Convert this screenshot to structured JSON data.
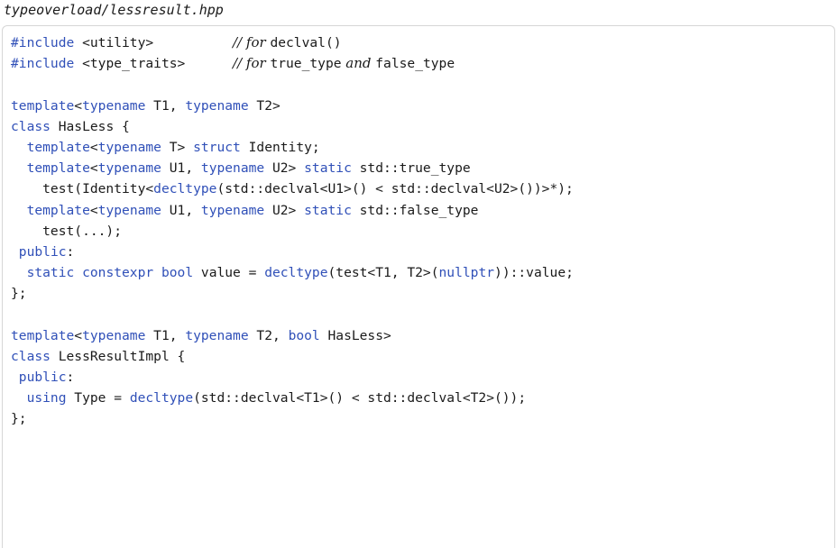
{
  "file_title": "typeoverload/lessresult.hpp",
  "colors": {
    "keyword": "#3050b8",
    "text": "#1a1a1a",
    "border": "#d6d6d6"
  },
  "code_lines": [
    [
      {
        "t": "#include",
        "c": "pp"
      },
      {
        "t": " <utility>          ",
        "c": "plain"
      },
      {
        "t": "// for ",
        "c": "cm"
      },
      {
        "t": "declval()",
        "c": "cm-code"
      }
    ],
    [
      {
        "t": "#include",
        "c": "pp"
      },
      {
        "t": " <type_traits>      ",
        "c": "plain"
      },
      {
        "t": "// for ",
        "c": "cm"
      },
      {
        "t": "true_type",
        "c": "cm-code"
      },
      {
        "t": " and ",
        "c": "cm"
      },
      {
        "t": "false_type",
        "c": "cm-code"
      }
    ],
    [],
    [
      {
        "t": "template",
        "c": "kw"
      },
      {
        "t": "<",
        "c": "plain"
      },
      {
        "t": "typename",
        "c": "kw"
      },
      {
        "t": " T1, ",
        "c": "plain"
      },
      {
        "t": "typename",
        "c": "kw"
      },
      {
        "t": " T2>",
        "c": "plain"
      }
    ],
    [
      {
        "t": "class",
        "c": "kw"
      },
      {
        "t": " HasLess {",
        "c": "plain"
      }
    ],
    [
      {
        "t": "  ",
        "c": "plain"
      },
      {
        "t": "template",
        "c": "kw"
      },
      {
        "t": "<",
        "c": "plain"
      },
      {
        "t": "typename",
        "c": "kw"
      },
      {
        "t": " T> ",
        "c": "plain"
      },
      {
        "t": "struct",
        "c": "kw"
      },
      {
        "t": " Identity;",
        "c": "plain"
      }
    ],
    [
      {
        "t": "  ",
        "c": "plain"
      },
      {
        "t": "template",
        "c": "kw"
      },
      {
        "t": "<",
        "c": "plain"
      },
      {
        "t": "typename",
        "c": "kw"
      },
      {
        "t": " U1, ",
        "c": "plain"
      },
      {
        "t": "typename",
        "c": "kw"
      },
      {
        "t": " U2> ",
        "c": "plain"
      },
      {
        "t": "static",
        "c": "kw"
      },
      {
        "t": " std::true_type",
        "c": "plain"
      }
    ],
    [
      {
        "t": "    test(Identity<",
        "c": "plain"
      },
      {
        "t": "decltype",
        "c": "kw"
      },
      {
        "t": "(std::declval<U1>() < std::declval<U2>())>*);",
        "c": "plain"
      }
    ],
    [
      {
        "t": "  ",
        "c": "plain"
      },
      {
        "t": "template",
        "c": "kw"
      },
      {
        "t": "<",
        "c": "plain"
      },
      {
        "t": "typename",
        "c": "kw"
      },
      {
        "t": " U1, ",
        "c": "plain"
      },
      {
        "t": "typename",
        "c": "kw"
      },
      {
        "t": " U2> ",
        "c": "plain"
      },
      {
        "t": "static",
        "c": "kw"
      },
      {
        "t": " std::false_type",
        "c": "plain"
      }
    ],
    [
      {
        "t": "    test(...);",
        "c": "plain"
      }
    ],
    [
      {
        "t": " ",
        "c": "plain"
      },
      {
        "t": "public",
        "c": "kw"
      },
      {
        "t": ":",
        "c": "plain"
      }
    ],
    [
      {
        "t": "  ",
        "c": "plain"
      },
      {
        "t": "static",
        "c": "kw"
      },
      {
        "t": " ",
        "c": "plain"
      },
      {
        "t": "constexpr",
        "c": "kw"
      },
      {
        "t": " ",
        "c": "plain"
      },
      {
        "t": "bool",
        "c": "kw"
      },
      {
        "t": " value = ",
        "c": "plain"
      },
      {
        "t": "decltype",
        "c": "kw"
      },
      {
        "t": "(test<T1, T2>(",
        "c": "plain"
      },
      {
        "t": "nullptr",
        "c": "kw"
      },
      {
        "t": "))::value;",
        "c": "plain"
      }
    ],
    [
      {
        "t": "};",
        "c": "plain"
      }
    ],
    [],
    [
      {
        "t": "template",
        "c": "kw"
      },
      {
        "t": "<",
        "c": "plain"
      },
      {
        "t": "typename",
        "c": "kw"
      },
      {
        "t": " T1, ",
        "c": "plain"
      },
      {
        "t": "typename",
        "c": "kw"
      },
      {
        "t": " T2, ",
        "c": "plain"
      },
      {
        "t": "bool",
        "c": "kw"
      },
      {
        "t": " HasLess>",
        "c": "plain"
      }
    ],
    [
      {
        "t": "class",
        "c": "kw"
      },
      {
        "t": " LessResultImpl {",
        "c": "plain"
      }
    ],
    [
      {
        "t": " ",
        "c": "plain"
      },
      {
        "t": "public",
        "c": "kw"
      },
      {
        "t": ":",
        "c": "plain"
      }
    ],
    [
      {
        "t": "  ",
        "c": "plain"
      },
      {
        "t": "using",
        "c": "kw"
      },
      {
        "t": " Type = ",
        "c": "plain"
      },
      {
        "t": "decltype",
        "c": "kw"
      },
      {
        "t": "(std::declval<T1>() < std::declval<T2>());",
        "c": "plain"
      }
    ],
    [
      {
        "t": "};",
        "c": "plain"
      }
    ]
  ]
}
